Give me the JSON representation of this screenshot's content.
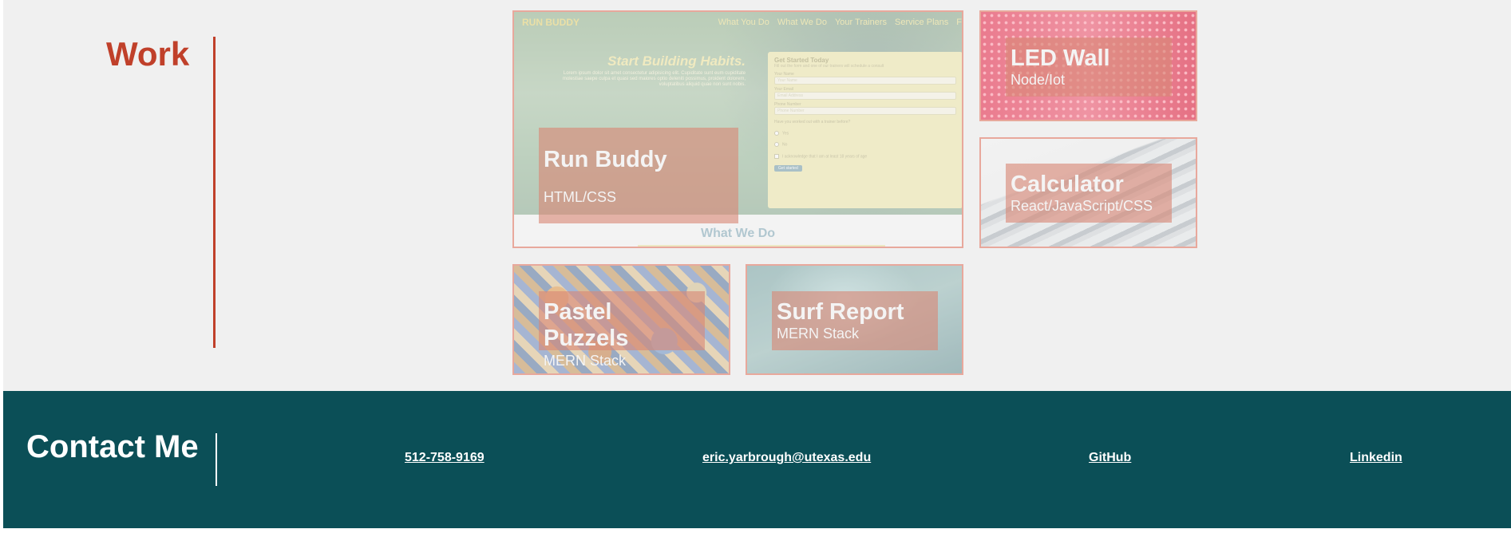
{
  "work": {
    "heading": "Work",
    "projects": [
      {
        "title": "Run Buddy",
        "tech": "HTML/CSS",
        "preview": {
          "logo": "RUN BUDDY",
          "nav": [
            "What You Do",
            "What We Do",
            "Your Trainers",
            "Service Plans",
            "F"
          ],
          "hero_title": "Start Building Habits.",
          "hero_text": "Lorem ipsum dolor sit amet consectetur adipisicing elit. Cupiditate sunt eum cupiditate molestiae saepe culpa et quasi sed maiores optio deleniti possimus, proident dolorem, voluptatibus aliquid quae non sunt nobis.",
          "form": {
            "title": "Get Started Today",
            "subtitle": "Fill out the form and one of our trainers will schedule a consult",
            "fields": [
              {
                "label": "Your Name",
                "placeholder": "Your Name"
              },
              {
                "label": "Your Email",
                "placeholder": "Email Address"
              },
              {
                "label": "Phone Number",
                "placeholder": "Phone Number"
              }
            ],
            "question": "Have you worked out with a trainer before?",
            "options": [
              "Yes",
              "No"
            ],
            "checkbox": "I acknowledge that I am at least 18 years of age",
            "button": "Get started"
          },
          "section_title": "What We Do"
        }
      },
      {
        "title": "LED Wall",
        "tech": "Node/Iot"
      },
      {
        "title": "Calculator",
        "tech": "React/JavaScript/CSS"
      },
      {
        "title": "Pastel Puzzels",
        "tech": "MERN Stack"
      },
      {
        "title": "Surf Report",
        "tech": "MERN Stack"
      }
    ]
  },
  "contact": {
    "heading": "Contact Me",
    "phone": "512-758-9169",
    "email": "eric.yarbrough@utexas.edu",
    "github": "GitHub",
    "linkedin": "Linkedin"
  },
  "colors": {
    "accent": "#c0402a",
    "footer_bg": "#0b4f57",
    "card_border": "#e8a89c",
    "caption_bg": "#d88876"
  }
}
